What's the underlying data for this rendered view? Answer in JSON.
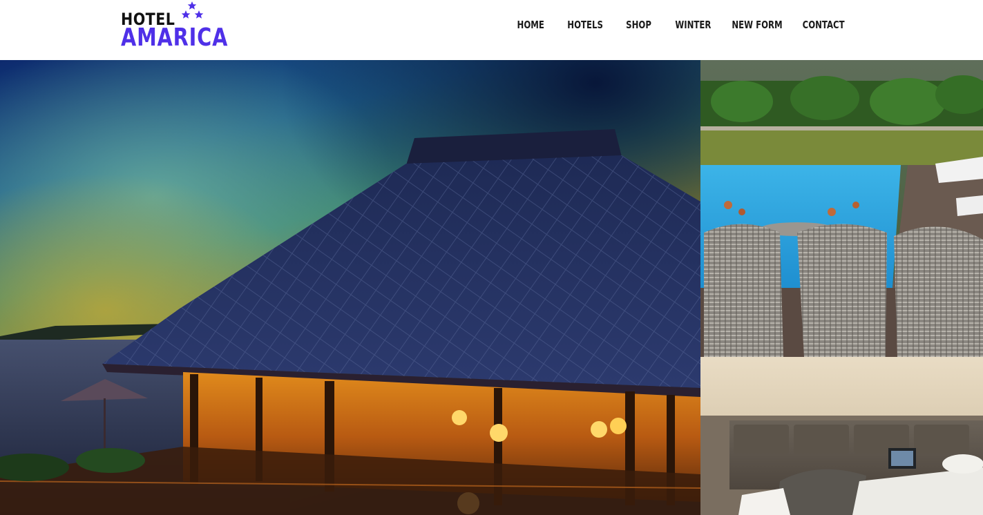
{
  "brand": {
    "line1": "HOTEL",
    "line2": "AMARICA",
    "accent_color": "#4f30e8",
    "icon": "three-stars"
  },
  "nav": {
    "items": [
      {
        "label": "HOME"
      },
      {
        "label": "HOTELS"
      },
      {
        "label": "SHOP"
      },
      {
        "label": "WINTER"
      },
      {
        "label": "NEW FORM"
      },
      {
        "label": "CONTACT"
      }
    ]
  },
  "hero": {
    "main_image": "resort-pavilion-at-night-photo",
    "side_top_image": "poolside-wicker-chairs-photo",
    "side_bottom_image": "hotel-bedroom-photo"
  }
}
